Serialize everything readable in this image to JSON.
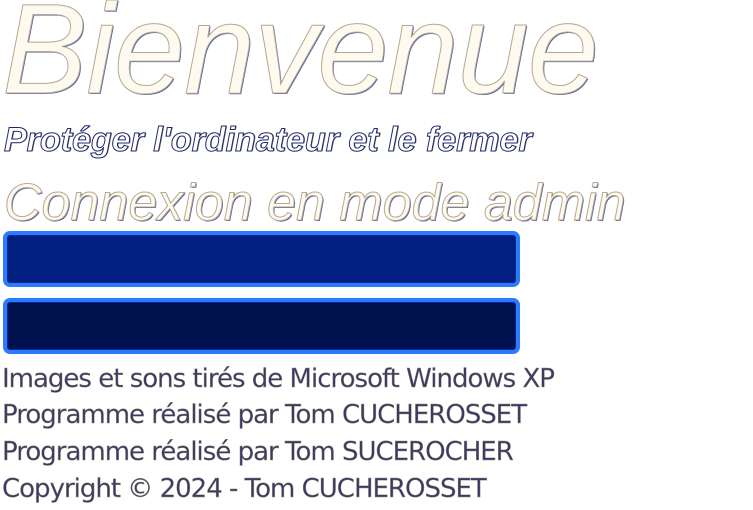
{
  "header": {
    "welcome": "Bienvenue",
    "shutdown_caption": "Protéger l'ordinateur et le fermer",
    "mode": "Connexion en mode admin"
  },
  "login": {
    "user_field_value": "",
    "password_field_value": "",
    "field_border_color": "#2a7bff",
    "user_field_color": "#001f80",
    "password_field_color": "#001150"
  },
  "credits": {
    "line1": "Images et sons tirés de Microsoft Windows XP",
    "line2": "Programme réalisé par Tom CUCHEROSSET",
    "line3": "Programme réalisé par Tom SUCEROCHER",
    "line4": "Copyright © 2024 - Tom CUCHEROSSET"
  }
}
